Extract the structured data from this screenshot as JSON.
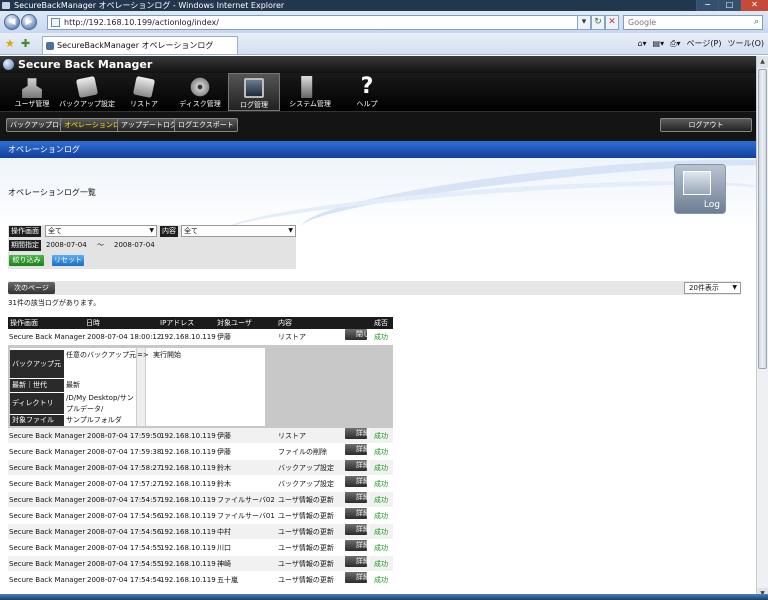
{
  "window": {
    "title": "SecureBackManager オペレーションログ - Windows Internet Explorer"
  },
  "browser": {
    "url": "http://192.168.10.199/actionlog/index/",
    "search_placeholder": "Google",
    "tab_title": "SecureBackManager オペレーションログ",
    "page_menu": "ページ(P)",
    "tools_menu": "ツール(O)"
  },
  "app": {
    "name": "Secure Back Manager",
    "toolbar": [
      {
        "label": "ユーザ管理",
        "icon": "users-icon"
      },
      {
        "label": "バックアップ設定",
        "icon": "backup-settings-icon"
      },
      {
        "label": "リストア",
        "icon": "restore-icon"
      },
      {
        "label": "ディスク管理",
        "icon": "disk-icon"
      },
      {
        "label": "ログ管理",
        "icon": "log-monitor-icon"
      },
      {
        "label": "システム管理",
        "icon": "system-server-icon"
      },
      {
        "label": "ヘルプ",
        "icon": "help-question-icon"
      }
    ],
    "subnav": [
      "バックアップログ",
      "オペレーションログ",
      "アップデートログ",
      "ログエクスポート"
    ],
    "logout": "ログアウト",
    "page_title": "オペレーションログ",
    "log_badge": "Log"
  },
  "list_title": "オペレーションログ一覧",
  "filter": {
    "screen_label": "操作画面",
    "screen_value": "全て",
    "content_label": "内容",
    "content_value": "全て",
    "period_label": "期間指定",
    "date_from": "2008-07-04",
    "tilde": "〜",
    "date_to": "2008-07-04",
    "apply": "絞り込み",
    "reset": "リセット"
  },
  "pager": {
    "next": "次のページ",
    "per_page": "20件表示",
    "count": "31件の該当ログがあります。"
  },
  "table": {
    "headers": [
      "操作画面",
      "日時",
      "IPアドレス",
      "対象ユーザ",
      "内容",
      "成否"
    ],
    "first_row": {
      "screen": "Secure Back Manager",
      "time": "2008-07-04 18:00:12",
      "ip": "192.168.10.119",
      "user": "伊藤",
      "content": "リストア",
      "btn": "閉じる",
      "result": "成功"
    },
    "detail": {
      "rows": [
        {
          "label": "バックアップ元",
          "value": "任意のバックアップ元"
        },
        {
          "label": "最新｜世代",
          "value": "最新"
        },
        {
          "label": "ディレクトリ",
          "value": "/D/My Desktop/サンプルデータ/"
        },
        {
          "label": "対象ファイル",
          "value": "サンプルフォルダ"
        }
      ],
      "arrow": "=>",
      "result_text": "実行開始"
    },
    "rows": [
      {
        "screen": "Secure Back Manager",
        "time": "2008-07-04 17:59:50",
        "ip": "192.168.10.119",
        "user": "伊藤",
        "content": "リストア",
        "btn": "詳細",
        "result": "成功"
      },
      {
        "screen": "Secure Back Manager",
        "time": "2008-07-04 17:59:38",
        "ip": "192.168.10.119",
        "user": "伊藤",
        "content": "ファイルの削除",
        "btn": "詳細",
        "result": "成功"
      },
      {
        "screen": "Secure Back Manager",
        "time": "2008-07-04 17:58:27",
        "ip": "192.168.10.119",
        "user": "鈴木",
        "content": "バックアップ設定",
        "btn": "詳細",
        "result": "成功"
      },
      {
        "screen": "Secure Back Manager",
        "time": "2008-07-04 17:57:27",
        "ip": "192.168.10.119",
        "user": "鈴木",
        "content": "バックアップ設定",
        "btn": "詳細",
        "result": "成功"
      },
      {
        "screen": "Secure Back Manager",
        "time": "2008-07-04 17:54:57",
        "ip": "192.168.10.119",
        "user": "ファイルサーバ02",
        "content": "ユーザ情報の更新",
        "btn": "詳細",
        "result": "成功"
      },
      {
        "screen": "Secure Back Manager",
        "time": "2008-07-04 17:54:56",
        "ip": "192.168.10.119",
        "user": "ファイルサーバ01",
        "content": "ユーザ情報の更新",
        "btn": "詳細",
        "result": "成功"
      },
      {
        "screen": "Secure Back Manager",
        "time": "2008-07-04 17:54:56",
        "ip": "192.168.10.119",
        "user": "中村",
        "content": "ユーザ情報の更新",
        "btn": "詳細",
        "result": "成功"
      },
      {
        "screen": "Secure Back Manager",
        "time": "2008-07-04 17:54:55",
        "ip": "192.168.10.119",
        "user": "川口",
        "content": "ユーザ情報の更新",
        "btn": "詳細",
        "result": "成功"
      },
      {
        "screen": "Secure Back Manager",
        "time": "2008-07-04 17:54:55",
        "ip": "192.168.10.119",
        "user": "神崎",
        "content": "ユーザ情報の更新",
        "btn": "詳細",
        "result": "成功"
      },
      {
        "screen": "Secure Back Manager",
        "time": "2008-07-04 17:54:54",
        "ip": "192.168.10.119",
        "user": "五十嵐",
        "content": "ユーザ情報の更新",
        "btn": "詳細",
        "result": "成功"
      }
    ]
  }
}
